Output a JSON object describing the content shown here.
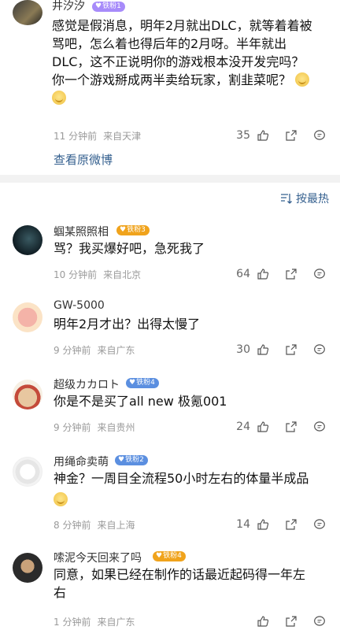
{
  "top_comment": {
    "username": "井汐汐",
    "badge": "铁粉1",
    "text_lines": [
      "感觉是假消息，明年2月就出DLC，就等着着被",
      "骂吧，怎么着也得后年的2月呀。半年就出",
      "DLC，这不正说明你的游戏根本没开发完吗？",
      "你一个游戏掰成两半卖给玩家，割韭菜呢？"
    ],
    "time": "11 分钟前",
    "location": "来自天津",
    "likes": "35",
    "view_original": "查看原微博"
  },
  "sort_label": "按最热",
  "comments": [
    {
      "username": "蝈某照照相",
      "badge": "铁粉3",
      "badge_color": "#f0a31c",
      "text_lines": [
        "骂？我买爆好吧，急死我了"
      ],
      "time": "10 分钟前",
      "location": "来自北京",
      "likes": "64"
    },
    {
      "username": "GW-5000",
      "badge": "",
      "badge_color": "",
      "text_lines": [
        "明年2月才出？出得太慢了"
      ],
      "time": "9 分钟前",
      "location": "来自广东",
      "likes": "30"
    },
    {
      "username": "超级カカロト",
      "badge": "铁粉4",
      "badge_color": "#5b8fe0",
      "text_lines": [
        "你是不是买了all new 极氪001"
      ],
      "time": "9 分钟前",
      "location": "来自贵州",
      "likes": "24"
    },
    {
      "username": "用绳命卖萌",
      "badge": "铁粉2",
      "badge_color": "#5b8fe0",
      "text_lines": [
        "神金？一周目全流程50小时左右的体量半成品"
      ],
      "time": "8 分钟前",
      "location": "来自上海",
      "likes": "14"
    },
    {
      "username": "嗦泥今天回来了吗",
      "badge": "铁粉4",
      "badge_color": "#f0a31c",
      "text_lines": [
        "同意，如果已经在制作的话最近起码得一年左",
        "右"
      ],
      "time": "1 分钟前",
      "location": "来自广东",
      "likes": ""
    }
  ],
  "colors": {
    "link": "#35608f",
    "meta": "#9a9a9a",
    "separator": "#f2f2f2",
    "badge_purple": "#a78bfa"
  }
}
